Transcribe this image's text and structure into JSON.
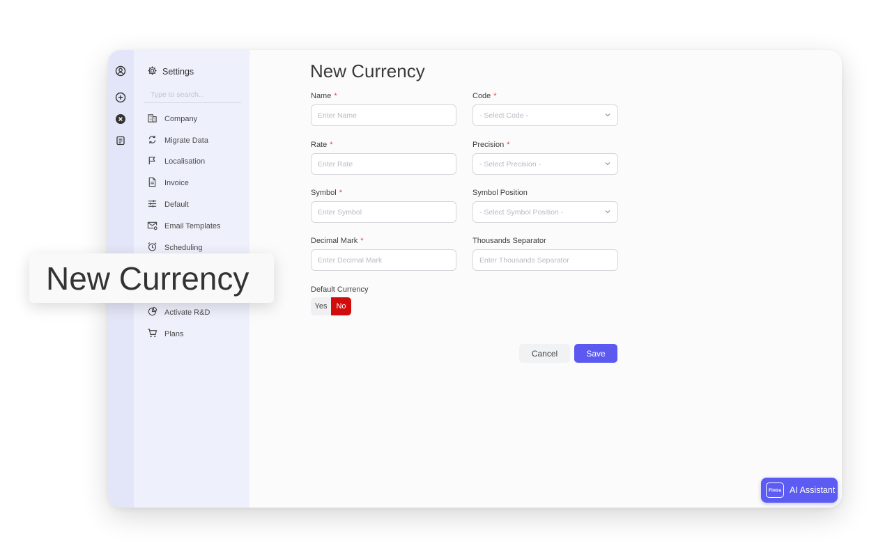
{
  "sidebar": {
    "title": "Settings",
    "search_placeholder": "Type to search...",
    "items": [
      {
        "label": "Company",
        "icon": "building-icon"
      },
      {
        "label": "Migrate Data",
        "icon": "sync-icon"
      },
      {
        "label": "Localisation",
        "icon": "flag-icon"
      },
      {
        "label": "Invoice",
        "icon": "document-icon"
      },
      {
        "label": "Default",
        "icon": "sliders-icon"
      },
      {
        "label": "Email Templates",
        "icon": "mail-settings-icon"
      },
      {
        "label": "Scheduling",
        "icon": "alarm-clock-icon"
      },
      {
        "label": "Activate R&D",
        "icon": "pie-chart-icon"
      },
      {
        "label": "Plans",
        "icon": "cart-icon"
      }
    ]
  },
  "page": {
    "title": "New Currency"
  },
  "form": {
    "name": {
      "label": "Name",
      "placeholder": "Enter Name"
    },
    "code": {
      "label": "Code",
      "placeholder": "- Select Code -"
    },
    "rate": {
      "label": "Rate",
      "placeholder": "Enter Rate"
    },
    "precision": {
      "label": "Precision",
      "placeholder": "- Select Precision -"
    },
    "symbol": {
      "label": "Symbol",
      "placeholder": "Enter Symbol"
    },
    "symbol_position": {
      "label": "Symbol Position",
      "placeholder": "- Select Symbol Position -"
    },
    "decimal_mark": {
      "label": "Decimal Mark",
      "placeholder": "Enter Decimal Mark"
    },
    "thousands_separator": {
      "label": "Thousands Separator",
      "placeholder": "Enter Thousands Separator"
    },
    "default_currency": {
      "label": "Default Currency",
      "yes": "Yes",
      "no": "No",
      "selected": "No"
    },
    "required_marker": "*"
  },
  "actions": {
    "cancel": "Cancel",
    "save": "Save"
  },
  "assistant": {
    "label": "AI Assistant",
    "logo_text": "Fintra"
  },
  "callout": {
    "text": "New Currency"
  },
  "colors": {
    "accent": "#5b59f0",
    "selected_no": "#d10c0c",
    "required": "#e0413d"
  }
}
